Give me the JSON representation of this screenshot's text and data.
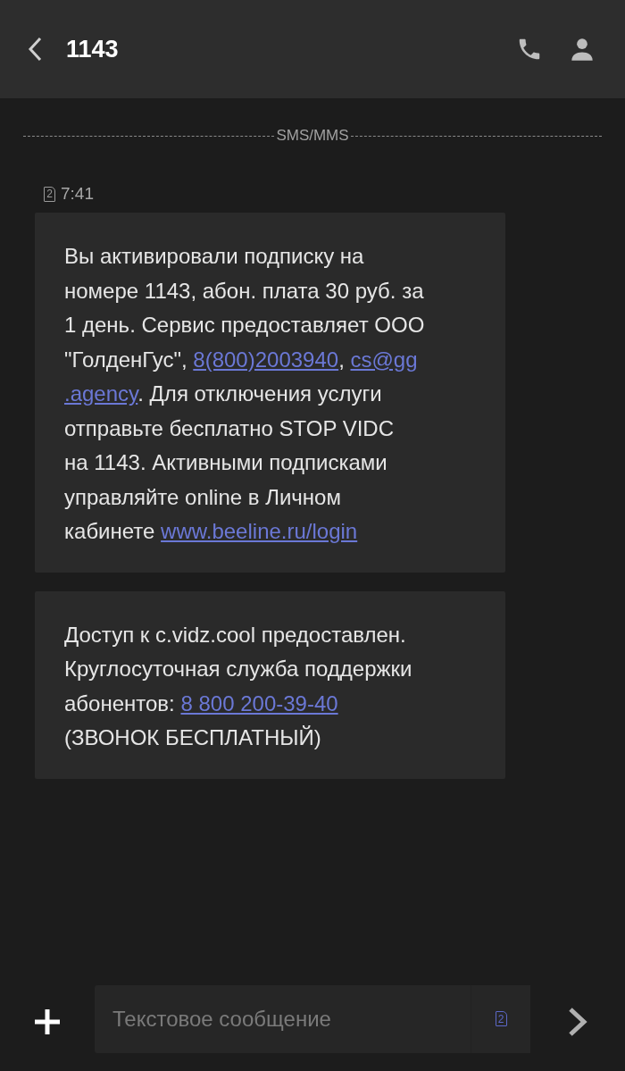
{
  "header": {
    "title": "1143"
  },
  "divider": {
    "label": "SMS/MMS"
  },
  "timestamp": {
    "sim": "2",
    "time": "7:41"
  },
  "messages": [
    {
      "lines": [
        [
          {
            "kind": "text",
            "text": "Вы активировали подписку на"
          }
        ],
        [
          {
            "kind": "text",
            "text": "номере 1143, абон. плата 30 руб. за"
          }
        ],
        [
          {
            "kind": "text",
            "text": "1 день. Сервис предоставляет ООО"
          }
        ],
        [
          {
            "kind": "text",
            "text": "\"ГолденГус\", "
          },
          {
            "kind": "link",
            "text": "8(800)2003940"
          },
          {
            "kind": "text",
            "text": ", "
          },
          {
            "kind": "link",
            "text": "cs@gg"
          }
        ],
        [
          {
            "kind": "link",
            "text": ".agency"
          },
          {
            "kind": "text",
            "text": ". Для отключения услуги"
          }
        ],
        [
          {
            "kind": "text",
            "text": "отправьте бесплатно STOP VIDC"
          }
        ],
        [
          {
            "kind": "text",
            "text": "на 1143. Активными подписками"
          }
        ],
        [
          {
            "kind": "text",
            "text": "управляйте online в Личном"
          }
        ],
        [
          {
            "kind": "text",
            "text": "кабинете "
          },
          {
            "kind": "link",
            "text": "www.beeline.ru/login"
          }
        ]
      ]
    },
    {
      "lines": [
        [
          {
            "kind": "text",
            "text": "Доступ к c.vidz.cool предоставлен."
          }
        ],
        [
          {
            "kind": "text",
            "text": "Круглосуточная служба поддержки"
          }
        ],
        [
          {
            "kind": "text",
            "text": "абонентов: "
          },
          {
            "kind": "link",
            "text": "8 800 200-39-40"
          }
        ],
        [
          {
            "kind": "text",
            "text": "(ЗВОНОК БЕСПЛАТНЫЙ)"
          }
        ]
      ]
    }
  ],
  "composer": {
    "placeholder": "Текстовое сообщение",
    "sim": "2"
  }
}
